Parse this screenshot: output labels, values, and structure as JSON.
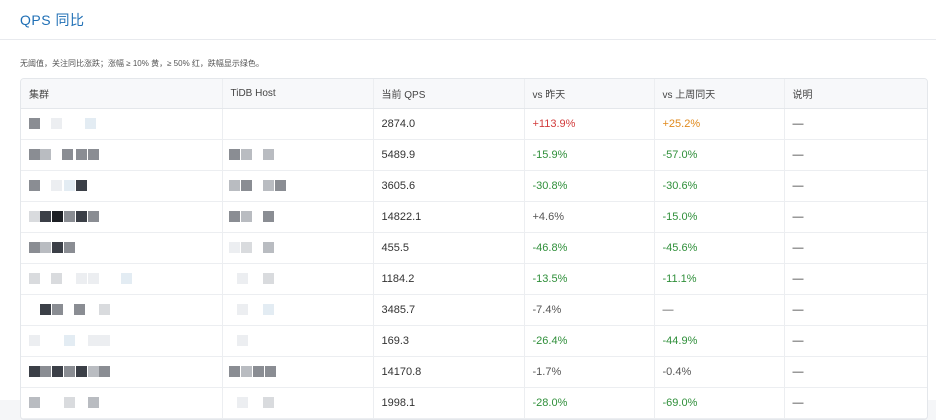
{
  "panel": {
    "title": "QPS 同比"
  },
  "note": "无阈值，关注同比涨跌；涨幅 ≥ 10% 黄，≥ 50% 红，跌幅显示绿色。",
  "table": {
    "headers": {
      "cluster": "集群",
      "host": "TiDB Host",
      "qps": "当前 QPS",
      "vs_yesterday": "vs 昨天",
      "vs_last_week": "vs 上周同天",
      "desc": "说明"
    },
    "rows": [
      {
        "qps": "2874.0",
        "vs_yesterday": "+113.9%",
        "vs_last_week": "+25.2%",
        "desc": "—"
      },
      {
        "qps": "5489.9",
        "vs_yesterday": "-15.9%",
        "vs_last_week": "-57.0%",
        "desc": "—"
      },
      {
        "qps": "3605.6",
        "vs_yesterday": "-30.8%",
        "vs_last_week": "-30.6%",
        "desc": "—"
      },
      {
        "qps": "14822.1",
        "vs_yesterday": "+4.6%",
        "vs_last_week": "-15.0%",
        "desc": "—"
      },
      {
        "qps": "455.5",
        "vs_yesterday": "-46.8%",
        "vs_last_week": "-45.6%",
        "desc": "—"
      },
      {
        "qps": "1184.2",
        "vs_yesterday": "-13.5%",
        "vs_last_week": "-11.1%",
        "desc": "—"
      },
      {
        "qps": "3485.7",
        "vs_yesterday": "-7.4%",
        "vs_last_week": "—",
        "desc": "—"
      },
      {
        "qps": "169.3",
        "vs_yesterday": "-26.4%",
        "vs_last_week": "-44.9%",
        "desc": "—"
      },
      {
        "qps": "14170.8",
        "vs_yesterday": "-1.7%",
        "vs_last_week": "-0.4%",
        "desc": "—"
      },
      {
        "qps": "1998.1",
        "vs_yesterday": "-28.0%",
        "vs_last_week": "-69.0%",
        "desc": "—"
      }
    ]
  },
  "colors": {
    "title": "#1f6fb5",
    "up_strong": "#d23c3c",
    "up_mild": "#e08a1e",
    "down": "#2f8f3a",
    "neutral": "#555555"
  }
}
